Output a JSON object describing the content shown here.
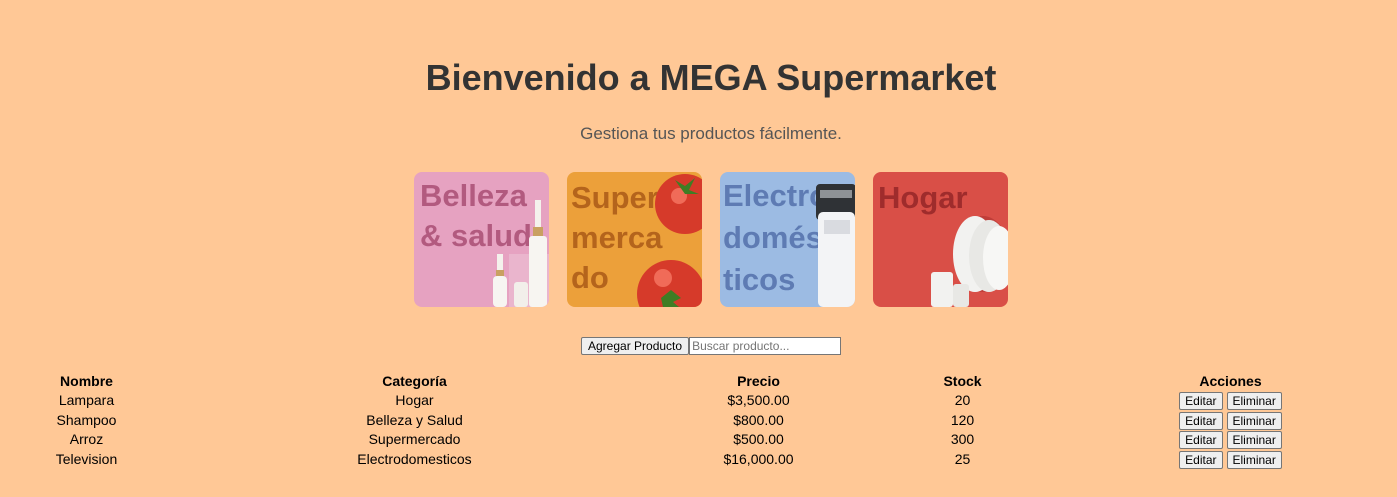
{
  "header": {
    "title": "Bienvenido a MEGA Supermarket",
    "subtitle": "Gestiona tus productos fácilmente."
  },
  "categories": [
    {
      "name": "belleza",
      "lines": [
        "Belleza",
        "& salud"
      ],
      "bg": "#e6a2c1",
      "text_color": "#b25a7f"
    },
    {
      "name": "supermercado",
      "lines": [
        "Super",
        "merca",
        "do"
      ],
      "bg": "#eca03a",
      "text_color": "#b4641c"
    },
    {
      "name": "electrodomesticos",
      "lines": [
        "Electro",
        "domés",
        "ticos"
      ],
      "bg": "#9cbbe3",
      "text_color": "#5e7bb3"
    },
    {
      "name": "hogar",
      "lines": [
        "Hogar"
      ],
      "bg": "#d94f47",
      "text_color": "#9f2c2c"
    }
  ],
  "controls": {
    "add_label": "Agregar Producto",
    "search_placeholder": "Buscar producto..."
  },
  "table": {
    "headers": [
      "Nombre",
      "Categoría",
      "Precio",
      "Stock",
      "Acciones"
    ],
    "rows": [
      {
        "nombre": "Lampara",
        "categoria": "Hogar",
        "precio": "$3,500.00",
        "stock": "20"
      },
      {
        "nombre": "Shampoo",
        "categoria": "Belleza y Salud",
        "precio": "$800.00",
        "stock": "120"
      },
      {
        "nombre": "Arroz",
        "categoria": "Supermercado",
        "precio": "$500.00",
        "stock": "300"
      },
      {
        "nombre": "Television",
        "categoria": "Electrodomesticos",
        "precio": "$16,000.00",
        "stock": "25"
      }
    ],
    "edit_label": "Editar",
    "delete_label": "Eliminar"
  }
}
